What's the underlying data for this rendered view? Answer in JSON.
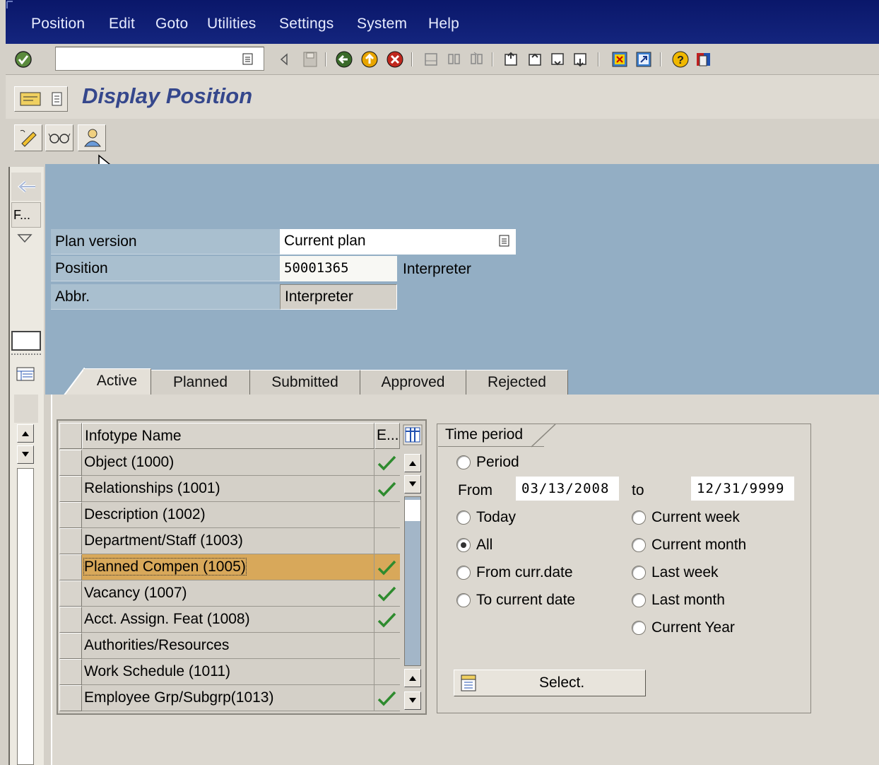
{
  "menu": [
    "Position",
    "Edit",
    "Goto",
    "Utilities",
    "Settings",
    "System",
    "Help"
  ],
  "title": "Display Position",
  "nav": {
    "folded_label": "F..."
  },
  "header": {
    "plan_version_label": "Plan version",
    "plan_version_value": "Current plan",
    "position_label": "Position",
    "position_value": "50001365",
    "position_text": "Interpreter",
    "abbr_label": "Abbr.",
    "abbr_value": "Interpreter"
  },
  "tabs": [
    "Active",
    "Planned",
    "Submitted",
    "Approved",
    "Rejected"
  ],
  "table": {
    "col_name": "Infotype Name",
    "col_exists": "E...",
    "rows": [
      {
        "name": "Object (1000)",
        "exists": true
      },
      {
        "name": "Relationships (1001)",
        "exists": true
      },
      {
        "name": "Description (1002)",
        "exists": false
      },
      {
        "name": "Department/Staff (1003)",
        "exists": false
      },
      {
        "name": "Planned Compen (1005)",
        "exists": true
      },
      {
        "name": "Vacancy (1007)",
        "exists": true
      },
      {
        "name": "Acct. Assign. Feat (1008)",
        "exists": true
      },
      {
        "name": "Authorities/Resources",
        "exists": false
      },
      {
        "name": "Work Schedule (1011)",
        "exists": false
      },
      {
        "name": "Employee Grp/Subgrp(1013)",
        "exists": true
      }
    ]
  },
  "time_period": {
    "title": "Time period",
    "period": "Period",
    "from_label": "From",
    "from_value": "03/13/2008",
    "to_label": "to",
    "to_value": "12/31/9999",
    "today": "Today",
    "all": "All",
    "from_curr": "From curr.date",
    "to_curr": "To current date",
    "current_week": "Current week",
    "current_month": "Current month",
    "last_week": "Last week",
    "last_month": "Last month",
    "current_year": "Current Year",
    "selected": "All",
    "select_button": "Select."
  },
  "colors": {
    "menubar": "#0e1d6e",
    "title": "#35478c",
    "blue_area": "#93aec4",
    "highlight_row": "#d8a85a",
    "check": "#2e8b2e"
  }
}
